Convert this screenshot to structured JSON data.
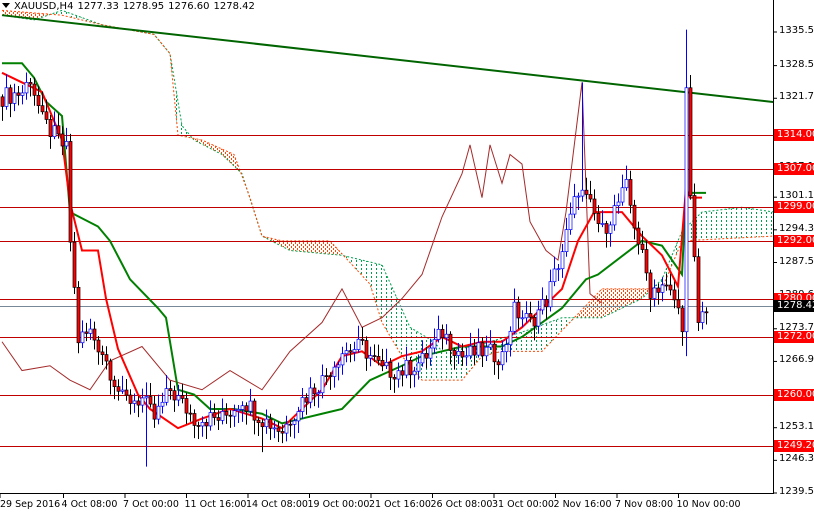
{
  "header": {
    "symbol": "XAUUSD,H4",
    "open": "1277.33",
    "high": "1278.95",
    "low": "1276.60",
    "close": "1278.42"
  },
  "colors": {
    "bull": "#0000ff",
    "bear_body": "#ff0000",
    "tenkan": "#ff0000",
    "kijun": "#008000",
    "chikou": "#a52a2a",
    "cloud_up": "#00a050",
    "cloud_down": "#ff4500",
    "level": "#c00000",
    "trend": "#006400"
  },
  "chart_data": {
    "type": "candlestick",
    "title": "XAUUSD,H4",
    "ylim": [
      1239.5,
      1335.5
    ],
    "price_ticks": [
      "1335.50",
      "1328.50",
      "1321.70",
      "1314.00",
      "1307.10",
      "1301.10",
      "1294.30",
      "1287.50",
      "1280.60",
      "1273.70",
      "1266.90",
      "1260.00",
      "1253.10",
      "1246.30",
      "1239.50"
    ],
    "time_ticks": [
      "29 Sep 2016",
      "4 Oct 08:00",
      "7 Oct 00:00",
      "11 Oct 16:00",
      "14 Oct 08:00",
      "19 Oct 00:00",
      "21 Oct 16:00",
      "26 Oct 08:00",
      "31 Oct 00:00",
      "2 Nov 16:00",
      "7 Nov 08:00",
      "10 Nov 00:00"
    ],
    "levels": [
      "1314.00",
      "1307.00",
      "1299.00",
      "1292.00",
      "1280.00",
      "1272.00",
      "1260.00",
      "1249.20"
    ],
    "current_price": "1278.42",
    "bars_total": 193,
    "trendline": [
      [
        0,
        1339.0
      ],
      [
        193,
        1320.9
      ]
    ],
    "close_keypoints": [
      [
        0,
        1322
      ],
      [
        5,
        1323
      ],
      [
        7,
        1326
      ],
      [
        10,
        1317
      ],
      [
        16,
        1311
      ],
      [
        17,
        1292
      ],
      [
        19,
        1271.5
      ],
      [
        22,
        1273
      ],
      [
        25,
        1269
      ],
      [
        30,
        1259
      ],
      [
        35,
        1259
      ],
      [
        38,
        1255
      ],
      [
        42,
        1261
      ],
      [
        48,
        1255
      ],
      [
        55,
        1255
      ],
      [
        60,
        1259
      ],
      [
        65,
        1255
      ],
      [
        70,
        1252.5
      ],
      [
        75,
        1259
      ],
      [
        80,
        1263
      ],
      [
        85,
        1269
      ],
      [
        90,
        1270
      ],
      [
        95,
        1265
      ],
      [
        100,
        1265
      ],
      [
        105,
        1267
      ],
      [
        110,
        1273
      ],
      [
        115,
        1268
      ],
      [
        120,
        1269
      ],
      [
        125,
        1268
      ],
      [
        128,
        1277.5
      ],
      [
        132,
        1275
      ],
      [
        136,
        1279.7
      ],
      [
        140,
        1290
      ],
      [
        144,
        1303
      ],
      [
        147,
        1299
      ],
      [
        150,
        1294
      ],
      [
        154,
        1300
      ],
      [
        156,
        1303
      ],
      [
        159,
        1292
      ],
      [
        162,
        1281.7
      ],
      [
        165,
        1283
      ],
      [
        168,
        1279.7
      ],
      [
        170,
        1275
      ],
      [
        171,
        1323
      ],
      [
        172,
        1300
      ],
      [
        174,
        1275
      ],
      [
        176,
        1278.4
      ]
    ],
    "spikes": [
      [
        36,
        null,
        1245
      ],
      [
        65,
        null,
        1248
      ],
      [
        145,
        1325,
        null
      ],
      [
        171,
        1336,
        1268
      ]
    ],
    "tenkan": [
      [
        0,
        1327
      ],
      [
        5,
        1325
      ],
      [
        10,
        1323
      ],
      [
        15,
        1313
      ],
      [
        17,
        1300
      ],
      [
        20,
        1290
      ],
      [
        24,
        1290
      ],
      [
        26,
        1280
      ],
      [
        29,
        1269.5
      ],
      [
        34,
        1260
      ],
      [
        37,
        1257
      ],
      [
        44,
        1253
      ],
      [
        50,
        1255
      ],
      [
        57,
        1257
      ],
      [
        65,
        1255
      ],
      [
        70,
        1253
      ],
      [
        75,
        1257
      ],
      [
        80,
        1261
      ],
      [
        85,
        1268
      ],
      [
        90,
        1269
      ],
      [
        95,
        1266
      ],
      [
        100,
        1268
      ],
      [
        105,
        1269
      ],
      [
        110,
        1272
      ],
      [
        115,
        1270
      ],
      [
        120,
        1271
      ],
      [
        125,
        1271
      ],
      [
        130,
        1274
      ],
      [
        135,
        1278
      ],
      [
        140,
        1282
      ],
      [
        144,
        1292
      ],
      [
        148,
        1298
      ],
      [
        155,
        1298
      ],
      [
        160,
        1293
      ],
      [
        165,
        1289
      ],
      [
        169,
        1282.5
      ],
      [
        171,
        1303
      ],
      [
        172,
        1301
      ],
      [
        175,
        1301
      ]
    ],
    "kijun": [
      [
        0,
        1329
      ],
      [
        5,
        1329
      ],
      [
        8,
        1326
      ],
      [
        11,
        1321
      ],
      [
        15,
        1318
      ],
      [
        17,
        1298
      ],
      [
        24,
        1295
      ],
      [
        27,
        1292
      ],
      [
        32,
        1284
      ],
      [
        39,
        1278
      ],
      [
        41,
        1276
      ],
      [
        44,
        1261
      ],
      [
        48,
        1260
      ],
      [
        52,
        1257
      ],
      [
        58,
        1257
      ],
      [
        65,
        1256
      ],
      [
        70,
        1254
      ],
      [
        75,
        1255
      ],
      [
        80,
        1256
      ],
      [
        85,
        1257
      ],
      [
        92,
        1263
      ],
      [
        100,
        1266
      ],
      [
        105,
        1268
      ],
      [
        110,
        1269
      ],
      [
        115,
        1270
      ],
      [
        125,
        1270
      ],
      [
        130,
        1272
      ],
      [
        135,
        1275
      ],
      [
        140,
        1278
      ],
      [
        144,
        1282
      ],
      [
        146,
        1284
      ],
      [
        149,
        1285
      ],
      [
        160,
        1292
      ],
      [
        165,
        1291
      ],
      [
        170,
        1285
      ],
      [
        171,
        1302
      ],
      [
        176,
        1302
      ]
    ],
    "senkou_a": [
      [
        0,
        1339
      ],
      [
        8,
        1338
      ],
      [
        15,
        1340
      ],
      [
        25,
        1337
      ],
      [
        38,
        1335
      ],
      [
        42,
        1331
      ],
      [
        45,
        1316
      ],
      [
        48,
        1313
      ],
      [
        55,
        1310
      ],
      [
        60,
        1306
      ],
      [
        65,
        1293
      ],
      [
        72,
        1290
      ],
      [
        85,
        1289
      ],
      [
        95,
        1287
      ],
      [
        102,
        1274
      ],
      [
        108,
        1271
      ],
      [
        110,
        1269
      ],
      [
        118,
        1270
      ],
      [
        130,
        1273
      ],
      [
        140,
        1276
      ],
      [
        150,
        1276
      ],
      [
        155,
        1278
      ],
      [
        160,
        1280
      ],
      [
        165,
        1284
      ],
      [
        170,
        1294
      ],
      [
        175,
        1298
      ],
      [
        185,
        1299
      ],
      [
        193,
        1298
      ]
    ],
    "senkou_b": [
      [
        0,
        1340
      ],
      [
        15,
        1339
      ],
      [
        25,
        1337
      ],
      [
        38,
        1335
      ],
      [
        42,
        1331
      ],
      [
        44,
        1314
      ],
      [
        50,
        1313
      ],
      [
        58,
        1310
      ],
      [
        62,
        1301
      ],
      [
        65,
        1293
      ],
      [
        70,
        1292
      ],
      [
        82,
        1292
      ],
      [
        92,
        1283
      ],
      [
        95,
        1275
      ],
      [
        100,
        1268
      ],
      [
        105,
        1263
      ],
      [
        115,
        1263
      ],
      [
        120,
        1268
      ],
      [
        125,
        1269
      ],
      [
        135,
        1269
      ],
      [
        150,
        1282
      ],
      [
        165,
        1282
      ],
      [
        170,
        1292
      ],
      [
        193,
        1293
      ]
    ],
    "chikou": [
      [
        0,
        1271
      ],
      [
        5,
        1265
      ],
      [
        12,
        1266
      ],
      [
        17,
        1263
      ],
      [
        22,
        1261
      ],
      [
        27,
        1267
      ],
      [
        35,
        1270
      ],
      [
        42,
        1263
      ],
      [
        50,
        1261
      ],
      [
        57,
        1265
      ],
      [
        65,
        1261
      ],
      [
        72,
        1269
      ],
      [
        80,
        1275
      ],
      [
        85,
        1282
      ],
      [
        90,
        1274
      ],
      [
        95,
        1276
      ],
      [
        100,
        1280
      ],
      [
        105,
        1285
      ],
      [
        110,
        1297
      ],
      [
        115,
        1306
      ],
      [
        117,
        1312
      ],
      [
        120,
        1301
      ],
      [
        122,
        1312
      ],
      [
        125,
        1304
      ],
      [
        127,
        1310
      ],
      [
        130,
        1308
      ],
      [
        132,
        1296
      ],
      [
        136,
        1290
      ],
      [
        139,
        1288
      ],
      [
        141,
        1298
      ],
      [
        145,
        1325
      ],
      [
        147,
        1281
      ],
      [
        150,
        1279
      ]
    ]
  }
}
